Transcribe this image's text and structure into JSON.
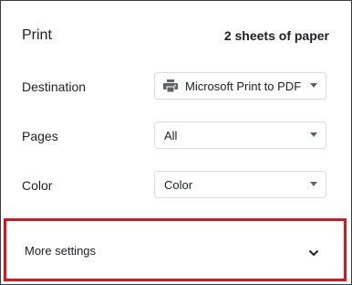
{
  "header": {
    "title": "Print",
    "sheet_count": "2 sheets of paper"
  },
  "destination": {
    "label": "Destination",
    "value": "Microsoft Print to PDF",
    "icon": "printer-icon"
  },
  "pages": {
    "label": "Pages",
    "value": "All"
  },
  "color": {
    "label": "Color",
    "value": "Color"
  },
  "more_settings": {
    "label": "More settings",
    "icon": "chevron-down-icon",
    "highlight_color": "#e0131a"
  }
}
